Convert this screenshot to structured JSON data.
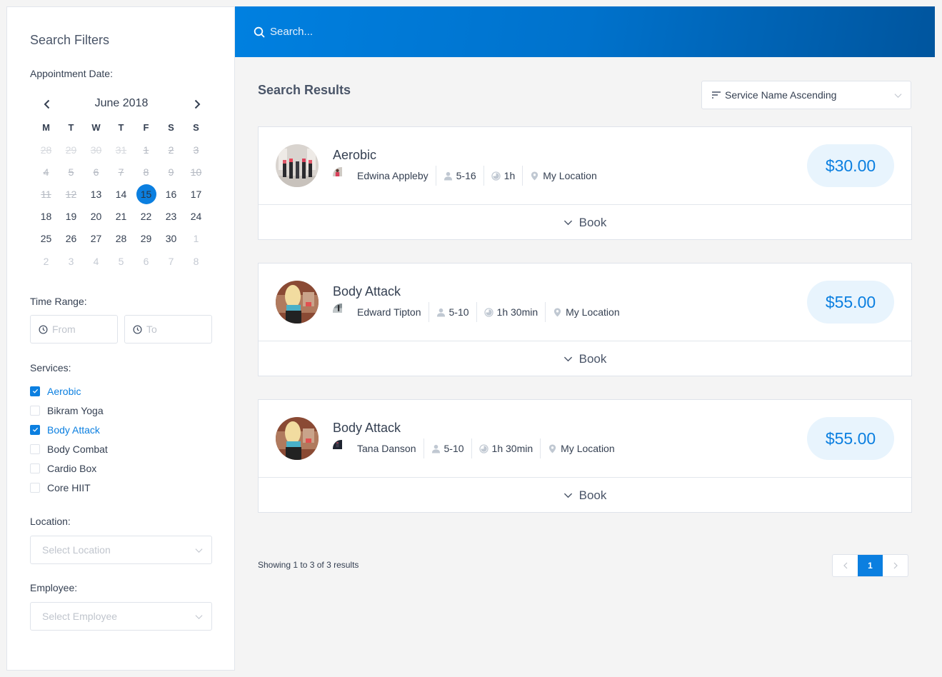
{
  "sidebar": {
    "title": "Search Filters",
    "appointment_date_label": "Appointment Date:",
    "calendar": {
      "month_label": "June 2018",
      "weekdays": [
        "M",
        "T",
        "W",
        "T",
        "F",
        "S",
        "S"
      ],
      "selected_day": 15,
      "weeks": [
        [
          {
            "d": "28",
            "s": "past-other"
          },
          {
            "d": "29",
            "s": "past-other"
          },
          {
            "d": "30",
            "s": "past-other"
          },
          {
            "d": "31",
            "s": "past-other"
          },
          {
            "d": "1",
            "s": "past"
          },
          {
            "d": "2",
            "s": "past"
          },
          {
            "d": "3",
            "s": "past"
          }
        ],
        [
          {
            "d": "4",
            "s": "past"
          },
          {
            "d": "5",
            "s": "past"
          },
          {
            "d": "6",
            "s": "past"
          },
          {
            "d": "7",
            "s": "past"
          },
          {
            "d": "8",
            "s": "past"
          },
          {
            "d": "9",
            "s": "past"
          },
          {
            "d": "10",
            "s": "past"
          }
        ],
        [
          {
            "d": "11",
            "s": "past"
          },
          {
            "d": "12",
            "s": "past"
          },
          {
            "d": "13",
            "s": "normal"
          },
          {
            "d": "14",
            "s": "normal"
          },
          {
            "d": "15",
            "s": "selected"
          },
          {
            "d": "16",
            "s": "normal"
          },
          {
            "d": "17",
            "s": "normal"
          }
        ],
        [
          {
            "d": "18",
            "s": "normal"
          },
          {
            "d": "19",
            "s": "normal"
          },
          {
            "d": "20",
            "s": "normal"
          },
          {
            "d": "21",
            "s": "normal"
          },
          {
            "d": "22",
            "s": "normal"
          },
          {
            "d": "23",
            "s": "normal"
          },
          {
            "d": "24",
            "s": "normal"
          }
        ],
        [
          {
            "d": "25",
            "s": "normal"
          },
          {
            "d": "26",
            "s": "normal"
          },
          {
            "d": "27",
            "s": "normal"
          },
          {
            "d": "28",
            "s": "normal"
          },
          {
            "d": "29",
            "s": "normal"
          },
          {
            "d": "30",
            "s": "normal"
          },
          {
            "d": "1",
            "s": "other"
          }
        ],
        [
          {
            "d": "2",
            "s": "other"
          },
          {
            "d": "3",
            "s": "other"
          },
          {
            "d": "4",
            "s": "other"
          },
          {
            "d": "5",
            "s": "other"
          },
          {
            "d": "6",
            "s": "other"
          },
          {
            "d": "7",
            "s": "other"
          },
          {
            "d": "8",
            "s": "other"
          }
        ]
      ]
    },
    "time_range_label": "Time Range:",
    "time_from_placeholder": "From",
    "time_to_placeholder": "To",
    "services_label": "Services:",
    "services": [
      {
        "name": "Aerobic",
        "checked": true
      },
      {
        "name": "Bikram Yoga",
        "checked": false
      },
      {
        "name": "Body Attack",
        "checked": true
      },
      {
        "name": "Body Combat",
        "checked": false
      },
      {
        "name": "Cardio Box",
        "checked": false
      },
      {
        "name": "Core HIIT",
        "checked": false
      }
    ],
    "location_label": "Location:",
    "location_placeholder": "Select Location",
    "employee_label": "Employee:",
    "employee_placeholder": "Select Employee"
  },
  "header": {
    "search_placeholder": "Search..."
  },
  "main": {
    "title": "Search Results",
    "sort_value": "Service Name Ascending",
    "results": [
      {
        "service": "Aerobic",
        "employee": "Edwina Appleby",
        "capacity": "5-16",
        "duration": "1h",
        "location": "My Location",
        "price": "$30.00",
        "book_label": "Book"
      },
      {
        "service": "Body Attack",
        "employee": "Edward Tipton",
        "capacity": "5-10",
        "duration": "1h 30min",
        "location": "My Location",
        "price": "$55.00",
        "book_label": "Book"
      },
      {
        "service": "Body Attack",
        "employee": "Tana Danson",
        "capacity": "5-10",
        "duration": "1h 30min",
        "location": "My Location",
        "price": "$55.00",
        "book_label": "Book"
      }
    ],
    "showing_text": "Showing 1 to 3 of 3 results",
    "pagination": {
      "current_page": "1"
    }
  },
  "colors": {
    "accent": "#0b7fe0",
    "header_gradient_start": "#0080e0",
    "header_gradient_end": "#00559e",
    "price_bg": "#e8f4fd",
    "text": "#354052"
  }
}
